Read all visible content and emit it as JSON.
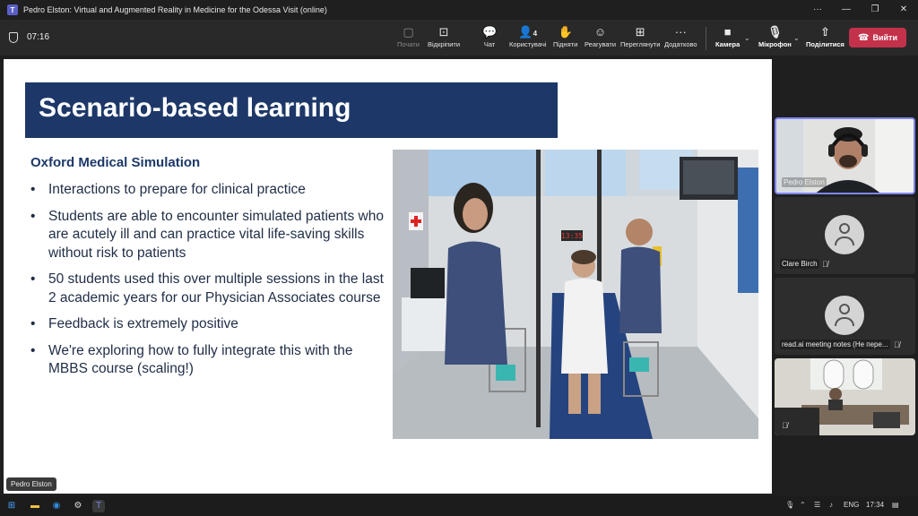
{
  "window": {
    "title": "Pedro Elston: Virtual and Augmented Reality in Medicine for the Odessa Visit (online)",
    "controls": [
      "···",
      "—",
      "❐",
      "✕"
    ]
  },
  "meeting": {
    "timer": "07:16",
    "toolbar": {
      "share": "Почати",
      "unpin": "Відкріпити",
      "chat": "Чат",
      "people": "Користувачі",
      "people_count": "4",
      "raise": "Підняти",
      "react": "Реагувати",
      "view": "Переглянути",
      "more": "Додатково",
      "camera": "Камера",
      "mic": "Мікрофон",
      "share_screen": "Поділитися",
      "leave": "Вийти"
    }
  },
  "slide": {
    "title": "Scenario-based learning",
    "subheading": "Oxford Medical Simulation",
    "bullets": [
      "Interactions to prepare for clinical practice",
      "Students are able to encounter simulated patients who are acutely ill and can practice vital life-saving skills without risk to patients",
      "50 students used this over multiple sessions in the last 2 academic years for our Physician Associates course",
      "Feedback is extremely positive",
      "We're exploring how to fully integrate this with the MBBS course (scaling!)"
    ],
    "scene_clock": "13:35",
    "presenter_label": "Pedro Elston"
  },
  "participants": [
    {
      "name": "Pedro Elston",
      "video": true,
      "active": true
    },
    {
      "name": "Clare Birch",
      "video": false,
      "muted": true
    },
    {
      "name": "read.ai meeting notes (Не пере...",
      "video": false,
      "muted": true
    },
    {
      "name": "",
      "video": true,
      "muted": true
    }
  ],
  "taskbar": {
    "language": "ENG",
    "clock": "17:34"
  },
  "colors": {
    "title_bg": "#1d3868",
    "leave_red": "#c4314b",
    "active_border": "#7f85f5"
  }
}
